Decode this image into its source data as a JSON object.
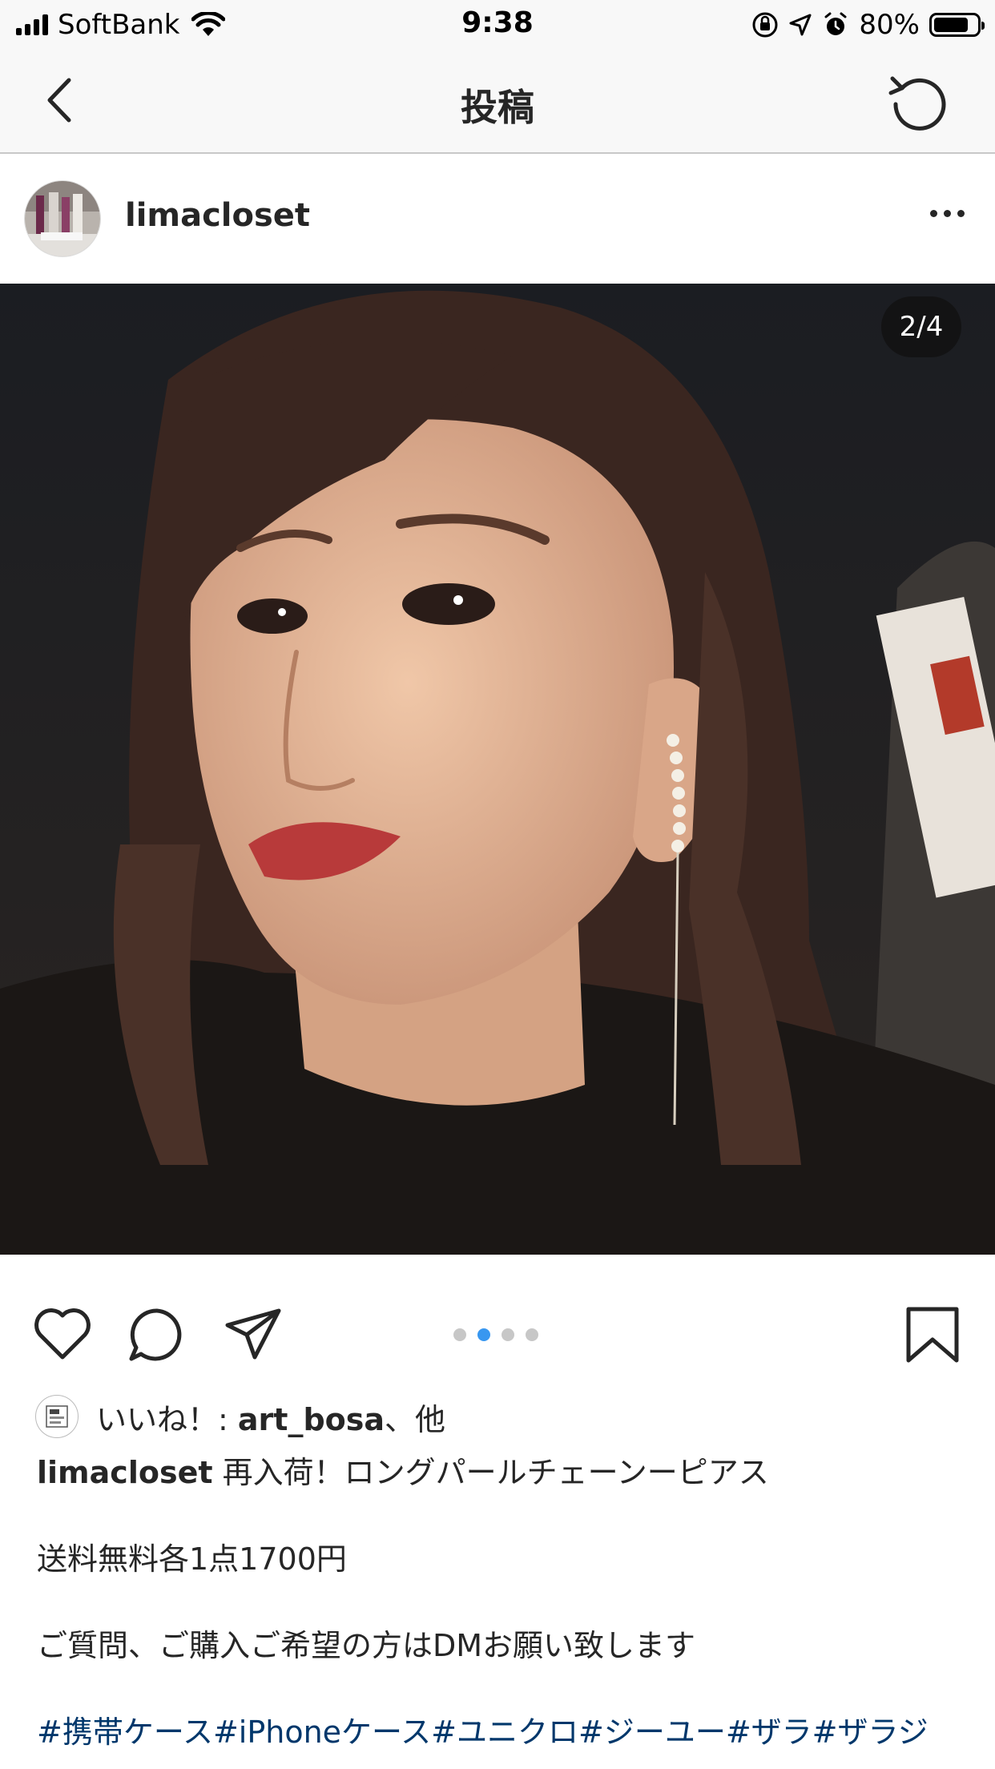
{
  "status_bar": {
    "carrier": "SoftBank",
    "time": "9:38",
    "battery_percent": "80%",
    "battery_level": 0.8,
    "icons": [
      "signal-icon",
      "wifi-icon",
      "orientation-lock-icon",
      "location-arrow-icon",
      "alarm-icon",
      "battery-icon"
    ]
  },
  "nav": {
    "title": "投稿",
    "back_icon": "chevron-left-icon",
    "refresh_icon": "refresh-icon"
  },
  "post": {
    "username": "limacloset",
    "more_icon": "more-horizontal-icon",
    "image_counter": "2/4",
    "carousel": {
      "total": 4,
      "current": 2
    },
    "actions": [
      "heart-icon",
      "comment-icon",
      "share-icon",
      "bookmark-icon"
    ],
    "likes": {
      "prefix": "いいね！: ",
      "user": "art_bosa",
      "suffix": "、他"
    },
    "caption": {
      "user": "limacloset",
      "line1": " 再入荷！ロングパールチェーンーピアス",
      "line2": "送料無料各1点1700円",
      "line3": "ご質問、ご購入ご希望の方はDMお願い致します",
      "hashtags": "#携帯ケース#iPhoneケース#ユニクロ#ジーユー#ザラ#ザラジ"
    }
  },
  "colors": {
    "accent_dot": "#3897f0",
    "hashtag": "#00376b",
    "text": "#262626",
    "bar_bg": "#f8f8f8"
  }
}
